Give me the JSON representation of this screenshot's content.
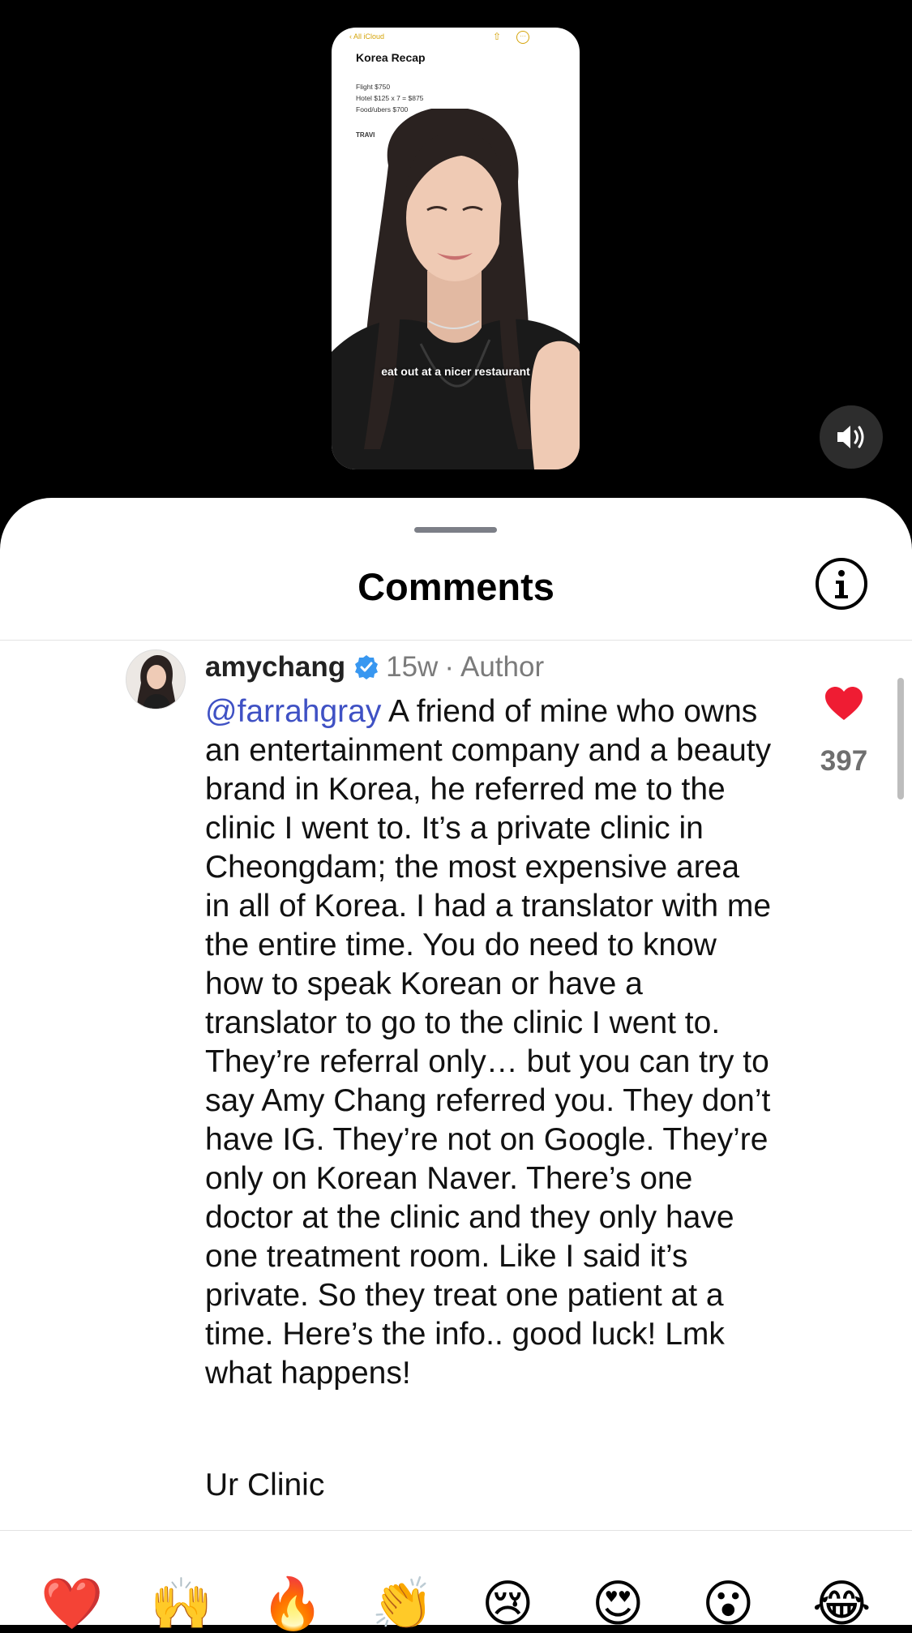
{
  "video": {
    "note": {
      "back_label": "All iCloud",
      "title": "Korea Recap",
      "lines": [
        "Flight $750",
        "Hotel $125 x 7 = $875",
        "Food/ubers $700"
      ],
      "section": "TRAVI"
    },
    "caption": "eat out at a nicer restaurant",
    "sound_icon": "speaker-on-icon"
  },
  "sheet": {
    "title": "Comments",
    "info_icon": "info-icon"
  },
  "comment": {
    "username": "amychang",
    "verified": true,
    "age": "15w",
    "separator": "·",
    "role": "Author",
    "mention": "@farrahgray",
    "text": " A friend of mine who owns an entertainment company and a beauty brand in Korea, he referred me to the clinic I went to. It’s a private clinic in Cheongdam; the most expensive area in all of Korea. I had a translator with me the entire time. You do need to know how to speak Korean or have a translator to go to the clinic I went to. They’re referral only… but you can try to say Amy Chang referred you. They don’t have IG. They’re not on Google. They’re only on Korean Naver. There’s one doctor at the clinic and they only have one treatment room. Like I said it’s private. So they treat one patient at a time. Here’s the info.. good luck! Lmk what happens!",
    "extra": "Ur Clinic",
    "likes": "397",
    "liked": true
  },
  "colors": {
    "mention": "#3f51c4",
    "heart": "#ef1c33",
    "verified": "#3897f0"
  },
  "reactions": [
    "❤️",
    "🙌",
    "🔥",
    "👏",
    "😢",
    "😍",
    "😮",
    "😂"
  ]
}
